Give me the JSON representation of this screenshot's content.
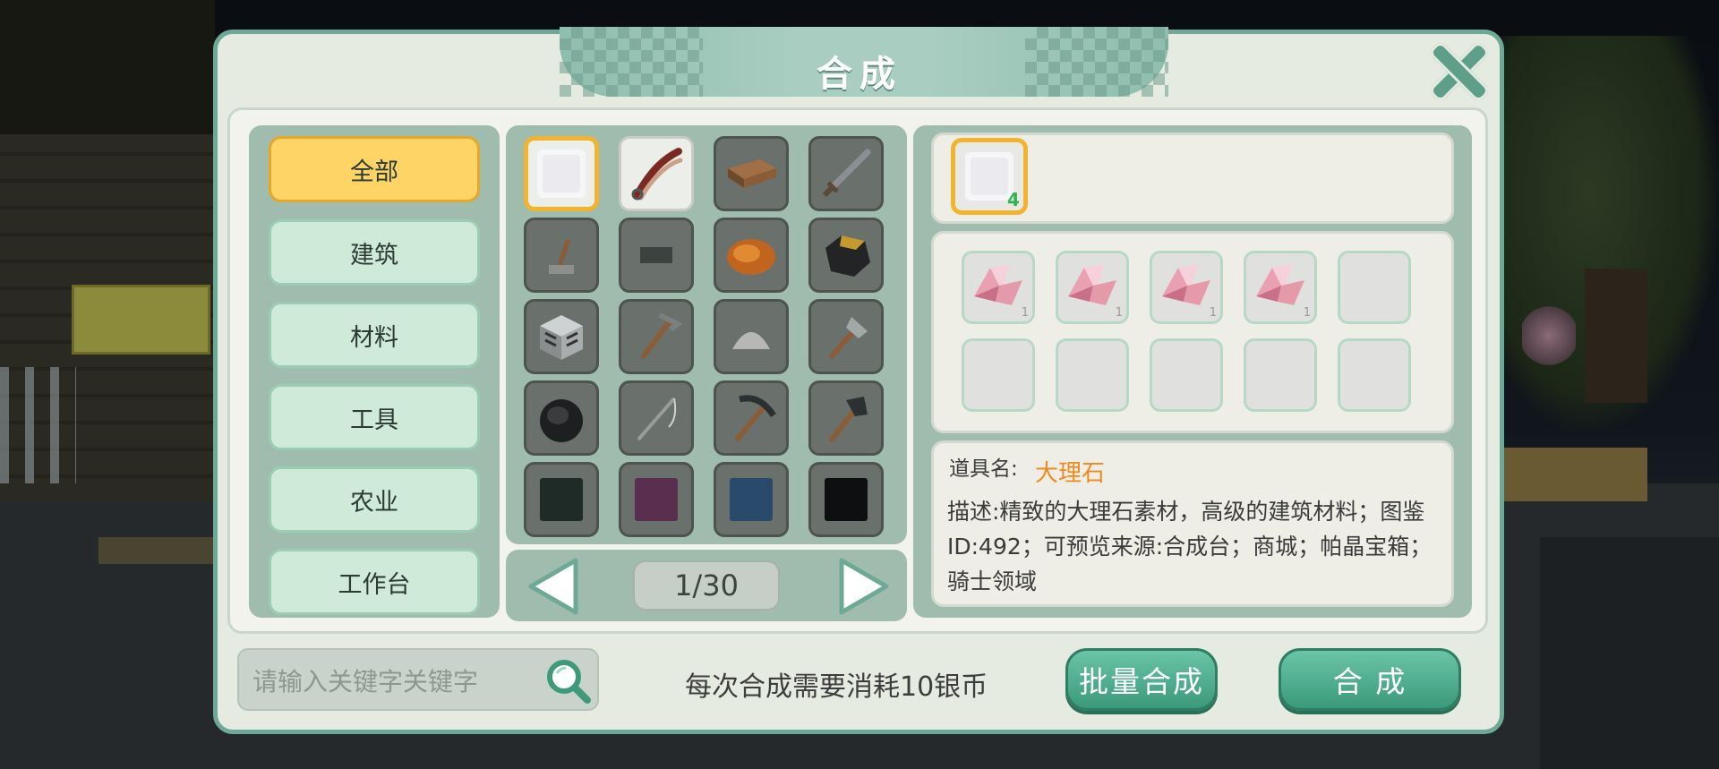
{
  "dialog": {
    "title": "合成"
  },
  "categories": [
    {
      "label": "全部",
      "active": true
    },
    {
      "label": "建筑",
      "active": false
    },
    {
      "label": "材料",
      "active": false
    },
    {
      "label": "工具",
      "active": false
    },
    {
      "label": "农业",
      "active": false
    },
    {
      "label": "工作台",
      "active": false
    }
  ],
  "grid": {
    "items": [
      {
        "icon": "marble-block-icon",
        "selected": true
      },
      {
        "icon": "tongs-icon",
        "light": true
      },
      {
        "icon": "wood-plank-icon"
      },
      {
        "icon": "sword-icon"
      },
      {
        "icon": "lever-icon"
      },
      {
        "icon": "stone-slab-icon"
      },
      {
        "icon": "roast-chicken-icon"
      },
      {
        "icon": "coal-ore-icon"
      },
      {
        "icon": "spawner-cage-icon"
      },
      {
        "icon": "hoe-icon"
      },
      {
        "icon": "dust-pile-icon"
      },
      {
        "icon": "shovel-icon"
      },
      {
        "icon": "bag-icon"
      },
      {
        "icon": "fishing-rod-icon"
      },
      {
        "icon": "pickaxe-icon"
      },
      {
        "icon": "axe-icon"
      },
      {
        "icon": "dark-green-block-icon"
      },
      {
        "icon": "purple-block-icon"
      },
      {
        "icon": "blue-block-icon"
      },
      {
        "icon": "black-block-icon"
      }
    ],
    "page": "1/30"
  },
  "recipe": {
    "result_icon": "marble-block-icon",
    "result_count": "4",
    "materials": [
      {
        "icon": "pink-crystal-icon",
        "count": "1"
      },
      {
        "icon": "pink-crystal-icon",
        "count": "1"
      },
      {
        "icon": "pink-crystal-icon",
        "count": "1"
      },
      {
        "icon": "pink-crystal-icon",
        "count": "1"
      },
      {
        "icon": "",
        "count": ""
      },
      {
        "icon": "",
        "count": ""
      },
      {
        "icon": "",
        "count": ""
      },
      {
        "icon": "",
        "count": ""
      },
      {
        "icon": "",
        "count": ""
      },
      {
        "icon": "",
        "count": ""
      }
    ]
  },
  "info": {
    "name_label": "道具名:",
    "name": "大理石",
    "description": "描述:精致的大理石素材，高级的建筑材料；图鉴ID:492；可预览来源:合成台；商城；帕晶宝箱；骑士领域"
  },
  "footer": {
    "search_placeholder": "请输入关键字关键字",
    "cost_text": "每次合成需要消耗10银币",
    "batch_button": "批量合成",
    "craft_button": "合 成"
  },
  "colors": {
    "accent": "#6da996",
    "active_category": "#fdd465",
    "item_name": "#f08a1e",
    "count_green": "#2fb64a"
  }
}
